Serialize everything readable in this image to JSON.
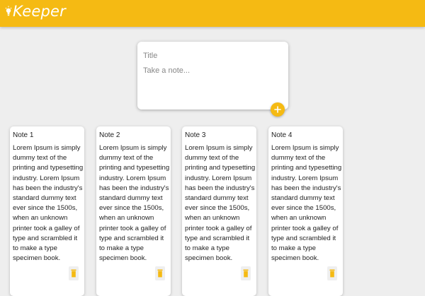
{
  "app": {
    "name": "Keeper",
    "accent_color": "#f5ba13",
    "logo_icon": "lightbulb-icon"
  },
  "create_note": {
    "title_placeholder": "Title",
    "content_placeholder": "Take a note...",
    "add_icon": "plus-icon"
  },
  "notes": [
    {
      "title": "Note 1",
      "content": "Lorem Ipsum is simply dummy text of the printing and typesetting industry. Lorem Ipsum has been the industry's standard dummy text ever since the 1500s, when an unknown printer took a galley of type and scrambled it to make a type specimen book.",
      "delete_icon": "trash-icon"
    },
    {
      "title": "Note 2",
      "content": "Lorem Ipsum is simply dummy text of the printing and typesetting industry. Lorem Ipsum has been the industry's standard dummy text ever since the 1500s, when an unknown printer took a galley of type and scrambled it to make a type specimen book.",
      "delete_icon": "trash-icon"
    },
    {
      "title": "Note 3",
      "content": "Lorem Ipsum is simply dummy text of the printing and typesetting industry. Lorem Ipsum has been the industry's standard dummy text ever since the 1500s, when an unknown printer took a galley of type and scrambled it to make a type specimen book.",
      "delete_icon": "trash-icon"
    },
    {
      "title": "Note 4",
      "content": "Lorem Ipsum is simply dummy text of the printing and typesetting industry. Lorem Ipsum has been the industry's standard dummy text ever since the 1500s, when an unknown printer took a galley of type and scrambled it to make a type specimen book.",
      "delete_icon": "trash-icon"
    }
  ]
}
